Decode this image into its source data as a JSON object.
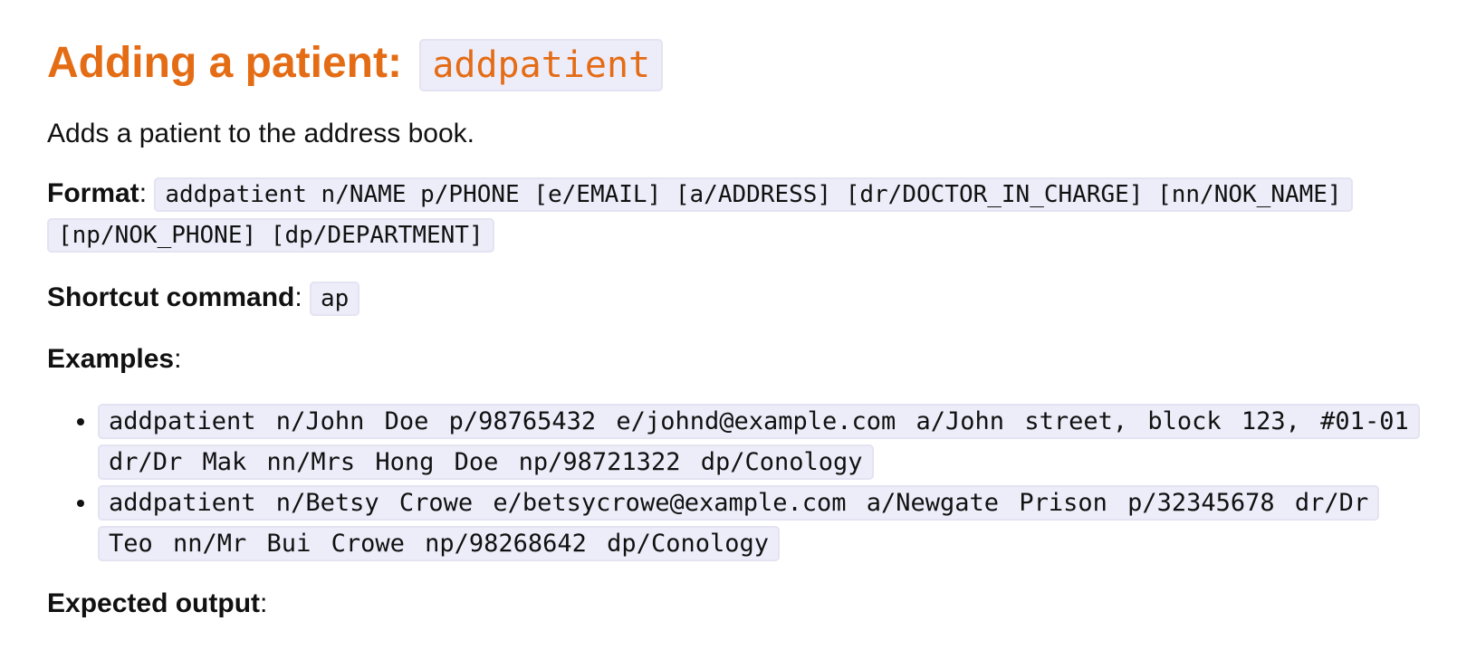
{
  "heading": {
    "text": "Adding a patient:",
    "command": "addpatient"
  },
  "description": "Adds a patient to the address book.",
  "format": {
    "label": "Format",
    "syntax": "addpatient n/NAME p/PHONE [e/EMAIL] [a/ADDRESS] [dr/DOCTOR_IN_CHARGE] [nn/NOK_NAME] [np/NOK_PHONE] [dp/DEPARTMENT]"
  },
  "shortcut": {
    "label": "Shortcut command",
    "value": "ap"
  },
  "examples": {
    "label": "Examples",
    "items": [
      "addpatient n/John Doe p/98765432 e/johnd@example.com a/John street, block 123, #01-01 dr/Dr Mak nn/Mrs Hong Doe np/98721322 dp/Conology",
      "addpatient n/Betsy Crowe e/betsycrowe@example.com a/Newgate Prison p/32345678 dr/Dr Teo nn/Mr Bui Crowe np/98268642 dp/Conology"
    ]
  },
  "expected_output": {
    "label": "Expected output"
  },
  "colors": {
    "heading": "#e46c15",
    "code_background": "#ededfa",
    "text": "#111111"
  }
}
